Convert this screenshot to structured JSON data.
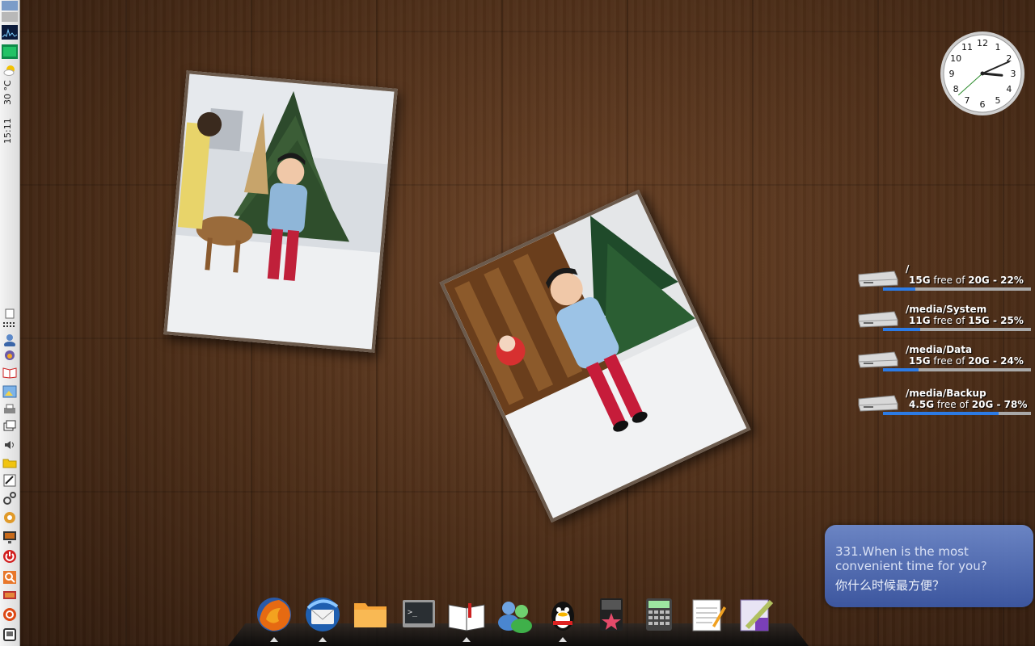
{
  "left_panel": {
    "weather_temp": "30 °C",
    "clock_time": "15:11",
    "icons": [
      "desktop-switcher-icon",
      "system-monitor-icon",
      "network-monitor-icon",
      "weather-icon",
      "show-desktop-icon",
      "apps-menu-icon",
      "user-icon",
      "pidgin-icon",
      "book-icon",
      "image-viewer-icon",
      "printer-icon",
      "window-list-icon",
      "volume-icon",
      "folder-icon",
      "network-icon",
      "settings-icon",
      "preferences-icon",
      "display-icon",
      "shutdown-icon",
      "search-icon",
      "battery-icon",
      "ubuntu-icon",
      "trash-icon"
    ]
  },
  "clock": {
    "hour": 3,
    "minute": 11,
    "second": 38,
    "numbers": [
      "12",
      "1",
      "2",
      "3",
      "4",
      "5",
      "6",
      "7",
      "8",
      "9",
      "10",
      "11"
    ]
  },
  "disks": [
    {
      "mount": "/",
      "free": "15G",
      "total": "20G",
      "percent_text": "22%",
      "usage_ratio": 0.22
    },
    {
      "mount": "/media/System",
      "free": "11G",
      "total": "15G",
      "percent_text": "25%",
      "usage_ratio": 0.25
    },
    {
      "mount": "/media/Data",
      "free": "15G",
      "total": "20G",
      "percent_text": "24%",
      "usage_ratio": 0.24
    },
    {
      "mount": "/media/Backup",
      "free": "4.5G",
      "total": "20G",
      "percent_text": "78%",
      "usage_ratio": 0.78
    }
  ],
  "disk_words": {
    "free_of": "free of",
    "sep": "-"
  },
  "notification": {
    "english": "331.When is the most convenient time for you?",
    "chinese": "你什么时候最方便？"
  },
  "dock": [
    {
      "name": "firefox-icon",
      "running": true
    },
    {
      "name": "thunderbird-icon",
      "running": true
    },
    {
      "name": "file-manager-icon",
      "running": false
    },
    {
      "name": "terminal-icon",
      "running": false
    },
    {
      "name": "dictionary-icon",
      "running": true
    },
    {
      "name": "messenger-icon",
      "running": false
    },
    {
      "name": "qq-icon",
      "running": true
    },
    {
      "name": "media-player-icon",
      "running": false
    },
    {
      "name": "calculator-icon",
      "running": false
    },
    {
      "name": "text-editor-icon",
      "running": false
    },
    {
      "name": "screenshot-tool-icon",
      "running": false
    }
  ],
  "colors": {
    "bar_fill": "#2c7be5",
    "notify_bg": "#4f6cc0"
  }
}
